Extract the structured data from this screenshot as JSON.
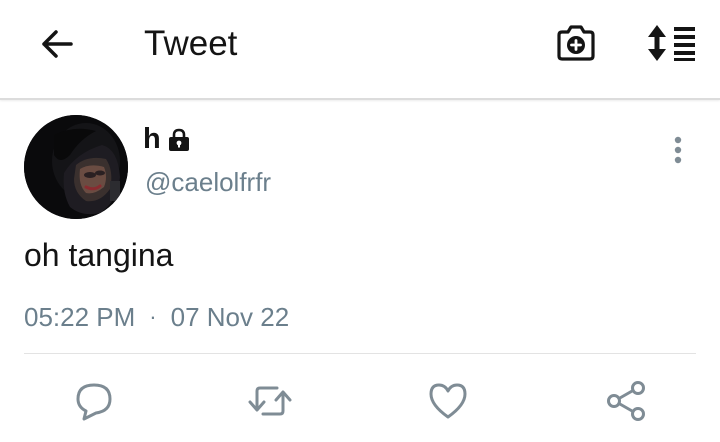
{
  "header": {
    "title": "Tweet",
    "back_icon": "arrow-left-icon",
    "camera_icon": "camera-plus-icon",
    "sort_icon": "sort-list-icon"
  },
  "tweet": {
    "display_name": "h",
    "protected_icon": "lock-icon",
    "handle": "@caelolfrfr",
    "text": "oh tangina",
    "time": "05:22 PM",
    "separator": "·",
    "date": "07 Nov 22",
    "more_icon": "vertical-ellipsis-icon"
  },
  "actions": {
    "reply_icon": "reply-bubble-icon",
    "retweet_icon": "retweet-icon",
    "like_icon": "heart-icon",
    "share_icon": "share-icon"
  },
  "colors": {
    "text_primary": "#141414",
    "text_secondary": "#6b7f8c",
    "icon_gray": "#7f8c95",
    "divider": "#e3e3e3"
  }
}
